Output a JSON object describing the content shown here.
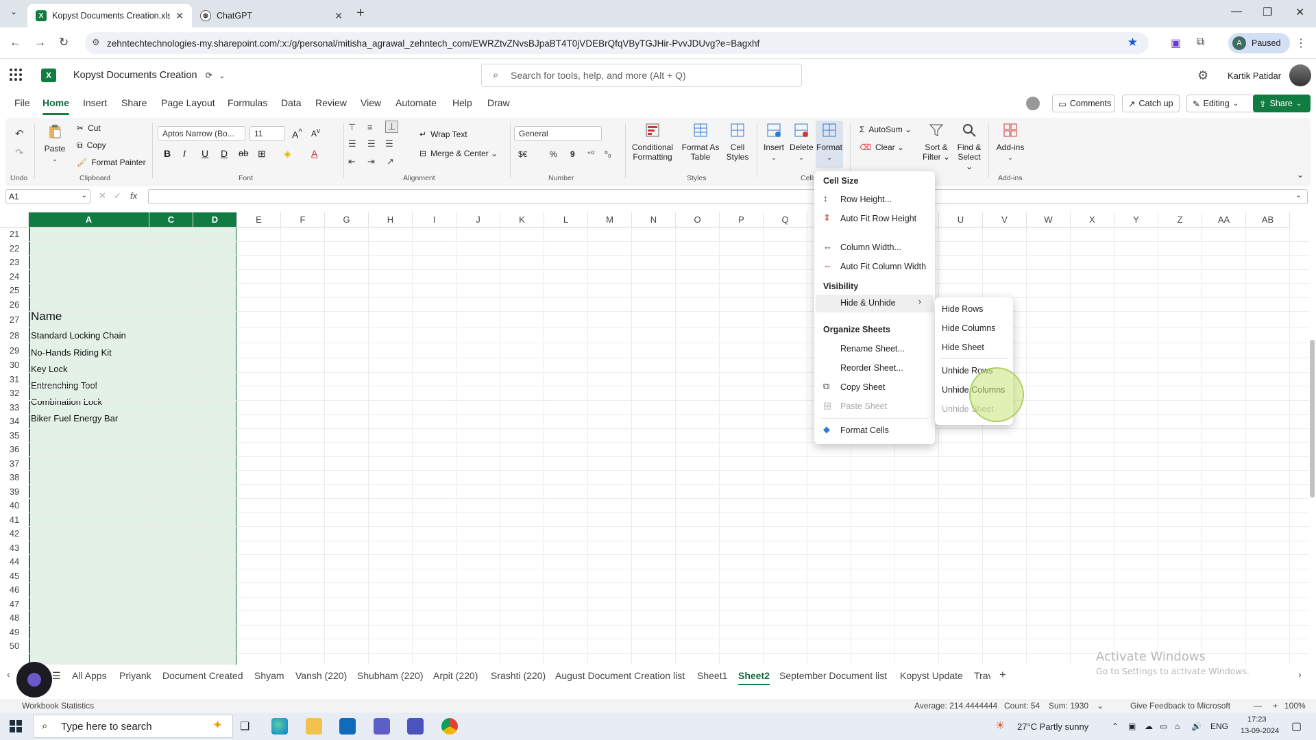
{
  "browser": {
    "tabs": [
      {
        "title": "Kopyst Documents Creation.xlsx",
        "active": true
      },
      {
        "title": "ChatGPT",
        "active": false
      }
    ],
    "url": "zehntechtechnologies-my.sharepoint.com/:x:/g/personal/mitisha_agrawal_zehntech_com/EWRZtvZNvsBJpaBT4T0jVDEBrQfqVByTGJHir-PvvJDUvg?e=Bagxhf",
    "profile_initial": "A",
    "profile_status": "Paused"
  },
  "excel": {
    "logo_letter": "X",
    "doc_title": "Kopyst Documents Creation",
    "search_placeholder": "Search for tools, help, and more (Alt + Q)",
    "user_name": "Kartik Patidar",
    "menu": [
      "File",
      "Home",
      "Insert",
      "Share",
      "Page Layout",
      "Formulas",
      "Data",
      "Review",
      "View",
      "Automate",
      "Help",
      "Draw"
    ],
    "active_menu": "Home",
    "header_buttons": {
      "comments": "Comments",
      "catchup": "Catch up",
      "editing": "Editing",
      "share": "Share"
    }
  },
  "ribbon": {
    "undo_label": "Undo",
    "paste": "Paste",
    "cut": "Cut",
    "copy": "Copy",
    "format_painter": "Format Painter",
    "clipboard_label": "Clipboard",
    "font_name": "Aptos Narrow (Bo...",
    "font_size": "11",
    "font_label": "Font",
    "wrap_text": "Wrap Text",
    "merge_center": "Merge & Center",
    "alignment_label": "Alignment",
    "number_format": "General",
    "number_label": "Number",
    "conditional_formatting": "Conditional Formatting",
    "format_as_table": "Format As Table",
    "cell_styles": "Cell Styles",
    "styles_label": "Styles",
    "insert": "Insert",
    "delete": "Delete",
    "format": "Format",
    "cells_label": "Cells",
    "autosum": "AutoSum",
    "clear": "Clear",
    "sort_filter": "Sort & Filter",
    "find_select": "Find & Select",
    "addins": "Add-ins",
    "addins_label": "Add-ins",
    "fmt_b": "B",
    "fmt_i": "I",
    "fmt_u": "U",
    "fmt_d": "D",
    "fmt_ab": "ab",
    "fmt_a": "A",
    "currency": "$€",
    "percent": "%",
    "comma": "9"
  },
  "formula_bar": {
    "name_box": "A1",
    "formula": ""
  },
  "grid": {
    "columns": [
      "A",
      "C",
      "D",
      "E",
      "F",
      "G",
      "H",
      "I",
      "J",
      "K",
      "L",
      "M",
      "N",
      "O",
      "P",
      "Q",
      "R",
      "S",
      "T",
      "U",
      "V",
      "W",
      "X",
      "Y",
      "Z",
      "AA",
      "AB"
    ],
    "rows": [
      "21",
      "22",
      "23",
      "24",
      "25",
      "26",
      "27",
      "28",
      "29",
      "30",
      "31",
      "32",
      "33",
      "34",
      "35",
      "36",
      "37",
      "38",
      "39",
      "40",
      "41",
      "42",
      "43",
      "44",
      "45",
      "46",
      "47",
      "48",
      "49",
      "50"
    ],
    "cells": {
      "r27": "Name",
      "r28": "Standard Locking Chain",
      "r29": "No-Hands Riding Kit",
      "r30": "Key Lock",
      "r31": "Entrenching Tool",
      "r32": "Combination Lock",
      "r33": "Biker Fuel Energy Bar"
    }
  },
  "format_menu": {
    "cell_size_header": "Cell Size",
    "row_height": "Row Height...",
    "autofit_row": "Auto Fit Row Height",
    "column_width": "Column Width...",
    "autofit_column": "Auto Fit Column Width",
    "visibility_header": "Visibility",
    "hide_unhide": "Hide & Unhide",
    "organize_header": "Organize Sheets",
    "rename_sheet": "Rename Sheet...",
    "reorder_sheet": "Reorder Sheet...",
    "copy_sheet": "Copy Sheet",
    "paste_sheet": "Paste Sheet",
    "format_cells": "Format Cells"
  },
  "hide_unhide_submenu": {
    "hide_rows": "Hide Rows",
    "hide_columns": "Hide Columns",
    "hide_sheet": "Hide Sheet",
    "unhide_rows": "Unhide Rows",
    "unhide_columns": "Unhide Columns",
    "unhide_sheet": "Unhide Sheet"
  },
  "sheet_tabs": [
    "All Apps",
    "Priyank",
    "Document Created",
    "Shyam",
    "Vansh (220)",
    "Shubham (220)",
    "Arpit (220)",
    "Srashti (220)",
    "August Document Creation list",
    "Sheet1",
    "Sheet2",
    "September Document list",
    "Kopyst Update",
    "Trav"
  ],
  "active_sheet": "Sheet2",
  "watermark": {
    "line1": "Activate Windows",
    "line2": "Go to Settings to activate Windows."
  },
  "status_bar": {
    "workbook_stats": "Workbook Statistics",
    "average": "Average: 214.4444444",
    "count": "Count: 54",
    "sum": "Sum: 1930",
    "feedback": "Give Feedback to Microsoft",
    "zoom": "100%"
  },
  "taskbar": {
    "search_placeholder": "Type here to search",
    "weather": "27°C  Partly sunny",
    "language": "ENG",
    "time": "17:23",
    "date": "13-09-2024"
  }
}
